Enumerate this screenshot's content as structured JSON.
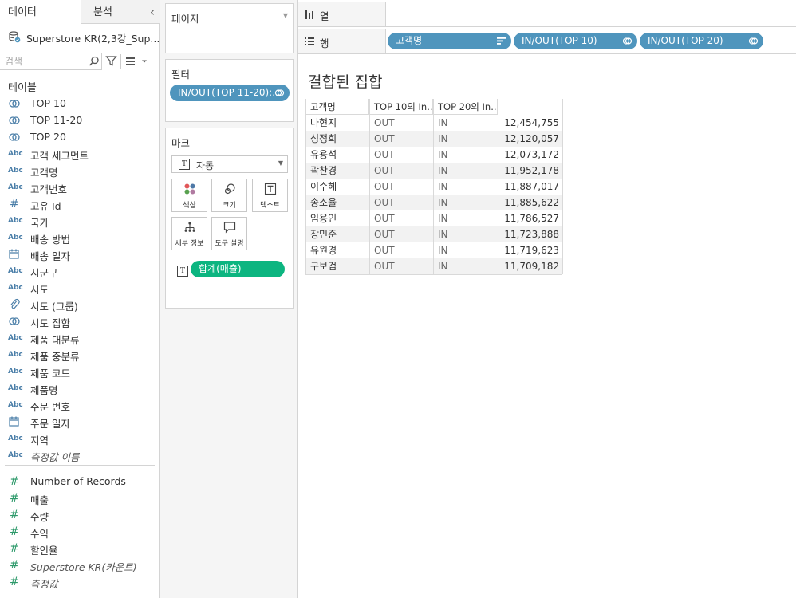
{
  "left_pane": {
    "tabs": [
      "데이터",
      "분석"
    ],
    "collapse_glyph": "‹",
    "datasource": "Superstore KR(2,3강_Sup...",
    "search_placeholder": "검색",
    "tables_header": "테이블",
    "fields": [
      {
        "icon": "set",
        "label": "TOP 10"
      },
      {
        "icon": "set",
        "label": "TOP 11-20"
      },
      {
        "icon": "set",
        "label": "TOP 20"
      },
      {
        "icon": "abc",
        "label": "고객 세그먼트"
      },
      {
        "icon": "abc",
        "label": "고객명"
      },
      {
        "icon": "abc",
        "label": "고객번호"
      },
      {
        "icon": "hash",
        "label": "고유 Id"
      },
      {
        "icon": "abc",
        "label": "국가"
      },
      {
        "icon": "abc",
        "label": "배송 방법"
      },
      {
        "icon": "calendar",
        "label": "배송 일자"
      },
      {
        "icon": "abc",
        "label": "시군구"
      },
      {
        "icon": "abc",
        "label": "시도"
      },
      {
        "icon": "paperclip",
        "label": "시도 (그룹)"
      },
      {
        "icon": "set",
        "label": "시도 집합"
      },
      {
        "icon": "abc",
        "label": "제품 대분류"
      },
      {
        "icon": "abc",
        "label": "제품 중분류"
      },
      {
        "icon": "abc",
        "label": "제품 코드"
      },
      {
        "icon": "abc",
        "label": "제품명"
      },
      {
        "icon": "abc",
        "label": "주문 번호"
      },
      {
        "icon": "calendar",
        "label": "주문 일자"
      },
      {
        "icon": "abc",
        "label": "지역"
      },
      {
        "icon": "abc",
        "label": "측정값 이름",
        "italic": true
      }
    ],
    "measures": [
      {
        "label": "Number of Records"
      },
      {
        "label": "매출"
      },
      {
        "label": "수량"
      },
      {
        "label": "수익"
      },
      {
        "label": "할인율"
      },
      {
        "label": "Superstore KR(카운트)",
        "italic": true
      },
      {
        "label": "측정값",
        "italic": true
      }
    ],
    "abc_text": "Abc"
  },
  "shelves": {
    "pages_title": "페이지",
    "filters_title": "필터",
    "filter_pill": "IN/OUT(TOP 11-20):...",
    "marks_title": "마크",
    "mark_type": "자동",
    "mark_buttons": [
      "색상",
      "크기",
      "텍스트",
      "세부 정보",
      "도구 설명"
    ],
    "sum_pill": "합계(매출)",
    "t_glyph": "T",
    "columns_label": "열",
    "rows_label": "행",
    "row_pills": [
      "고객명",
      "IN/OUT(TOP 10)",
      "IN/OUT(TOP 20)"
    ]
  },
  "view": {
    "title": "결합된 집합",
    "headers": [
      "고객명",
      "TOP 10의 In..",
      "TOP 20의 In.."
    ],
    "rows": [
      {
        "name": "나현지",
        "top10": "OUT",
        "top20": "IN",
        "value": "12,454,755"
      },
      {
        "name": "성정희",
        "top10": "OUT",
        "top20": "IN",
        "value": "12,120,057"
      },
      {
        "name": "유용석",
        "top10": "OUT",
        "top20": "IN",
        "value": "12,073,172"
      },
      {
        "name": "곽찬경",
        "top10": "OUT",
        "top20": "IN",
        "value": "11,952,178"
      },
      {
        "name": "이수혜",
        "top10": "OUT",
        "top20": "IN",
        "value": "11,887,017"
      },
      {
        "name": "송소율",
        "top10": "OUT",
        "top20": "IN",
        "value": "11,885,622"
      },
      {
        "name": "임용인",
        "top10": "OUT",
        "top20": "IN",
        "value": "11,786,527"
      },
      {
        "name": "장민준",
        "top10": "OUT",
        "top20": "IN",
        "value": "11,723,888"
      },
      {
        "name": "유원경",
        "top10": "OUT",
        "top20": "IN",
        "value": "11,719,623"
      },
      {
        "name": "구보검",
        "top10": "OUT",
        "top20": "IN",
        "value": "11,709,182"
      }
    ]
  },
  "colors": {
    "dimension_pill": "#4f95bd",
    "measure_pill": "#0cb580",
    "dimension_icon": "#4a7ea8",
    "measure_icon": "#2e9a6b"
  }
}
